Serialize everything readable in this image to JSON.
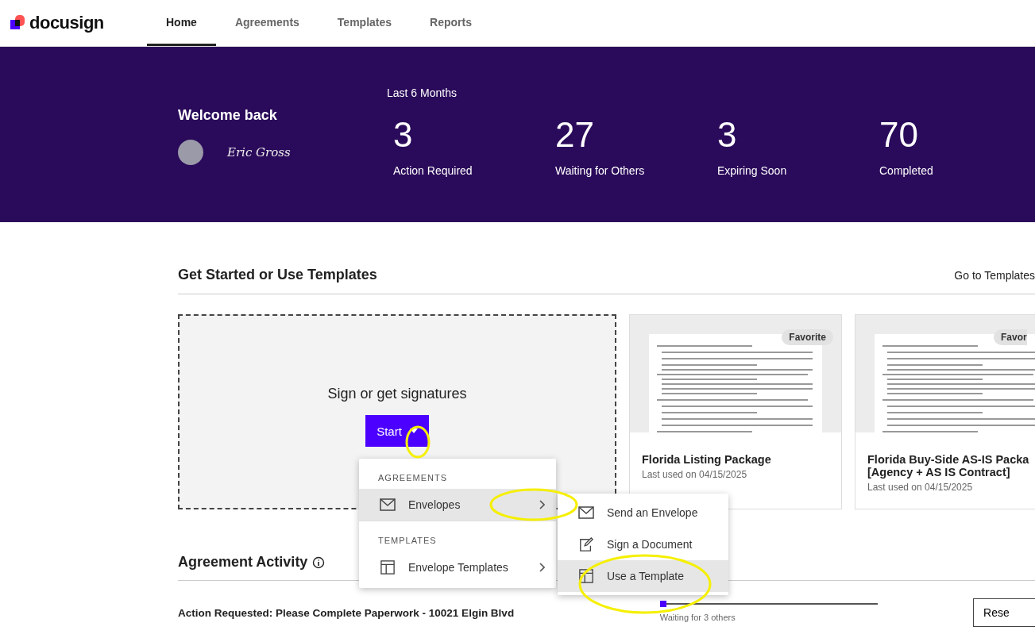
{
  "nav": {
    "brand": "docusign",
    "tabs": [
      {
        "label": "Home",
        "selected": true
      },
      {
        "label": "Agreements",
        "selected": false
      },
      {
        "label": "Templates",
        "selected": false
      },
      {
        "label": "Reports",
        "selected": false
      }
    ]
  },
  "header": {
    "welcome": "Welcome back",
    "signature": "Eric Gross",
    "period": "Last 6 Months",
    "stats": [
      {
        "value": "3",
        "label": "Action Required"
      },
      {
        "value": "27",
        "label": "Waiting for Others"
      },
      {
        "value": "3",
        "label": "Expiring Soon"
      },
      {
        "value": "70",
        "label": "Completed"
      }
    ]
  },
  "templates": {
    "title": "Get Started or Use Templates",
    "link": "Go to Templates",
    "start_card": {
      "prompt": "Sign or get signatures",
      "button": "Start"
    },
    "cards": [
      {
        "badge": "Favorite",
        "name": "Florida Listing Package",
        "last_used": "Last used on 04/15/2025"
      },
      {
        "badge": "Favor",
        "name": "Florida Buy-Side AS-IS Packa [Agency + AS IS Contract]",
        "last_used": "Last used on 04/15/2025"
      }
    ]
  },
  "menu": {
    "sections": [
      {
        "heading": "AGREEMENTS",
        "items": [
          {
            "label": "Envelopes",
            "selected": true
          }
        ]
      },
      {
        "heading": "TEMPLATES",
        "items": [
          {
            "label": "Envelope Templates",
            "selected": false
          }
        ]
      }
    ],
    "submenu": [
      {
        "label": "Send an Envelope",
        "selected": false
      },
      {
        "label": "Sign a Document",
        "selected": false
      },
      {
        "label": "Use a Template",
        "selected": true
      }
    ]
  },
  "activity": {
    "title": "Agreement Activity",
    "rows": [
      {
        "title": "Action Requested: Please Complete Paperwork - 10021 Elgin Blvd",
        "status": "Waiting for 3 others",
        "button": "Rese"
      }
    ]
  }
}
